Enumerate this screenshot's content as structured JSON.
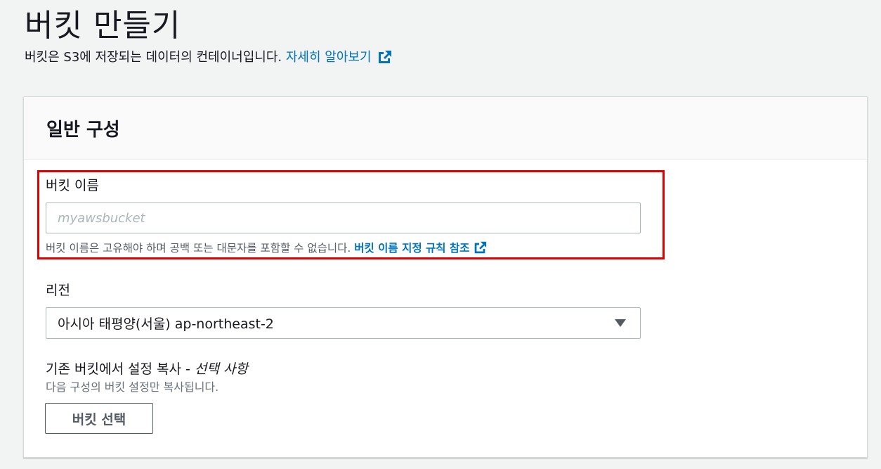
{
  "header": {
    "title": "버킷 만들기",
    "description": "버킷은 S3에 저장되는 데이터의 컨테이너입니다. ",
    "learn_more": "자세히 알아보기",
    "learn_more_icon": "external-link-icon"
  },
  "general_config": {
    "title": "일반 구성",
    "bucket_name": {
      "label": "버킷 이름",
      "value": "",
      "placeholder": "myawsbucket",
      "hint": "버킷 이름은 고유해야 하며 공백 또는 대문자를 포함할 수 없습니다. ",
      "hint_link": "버킷 이름 지정 규칙 참조",
      "hint_link_icon": "external-link-icon",
      "highlight_color": "#e00000"
    },
    "region": {
      "label": "리전",
      "selected": "아시아 태평양(서울) ap-northeast-2",
      "icon": "caret-down-icon"
    },
    "copy_settings": {
      "label": "기존 버킷에서 설정 복사 - ",
      "optional": "선택 사항",
      "description": "다음 구성의 버킷 설정만 복사됩니다.",
      "button": "버킷 선택"
    }
  },
  "colors": {
    "link": "#0073bb",
    "background": "#f2f3f3",
    "highlight": "#e00000"
  }
}
